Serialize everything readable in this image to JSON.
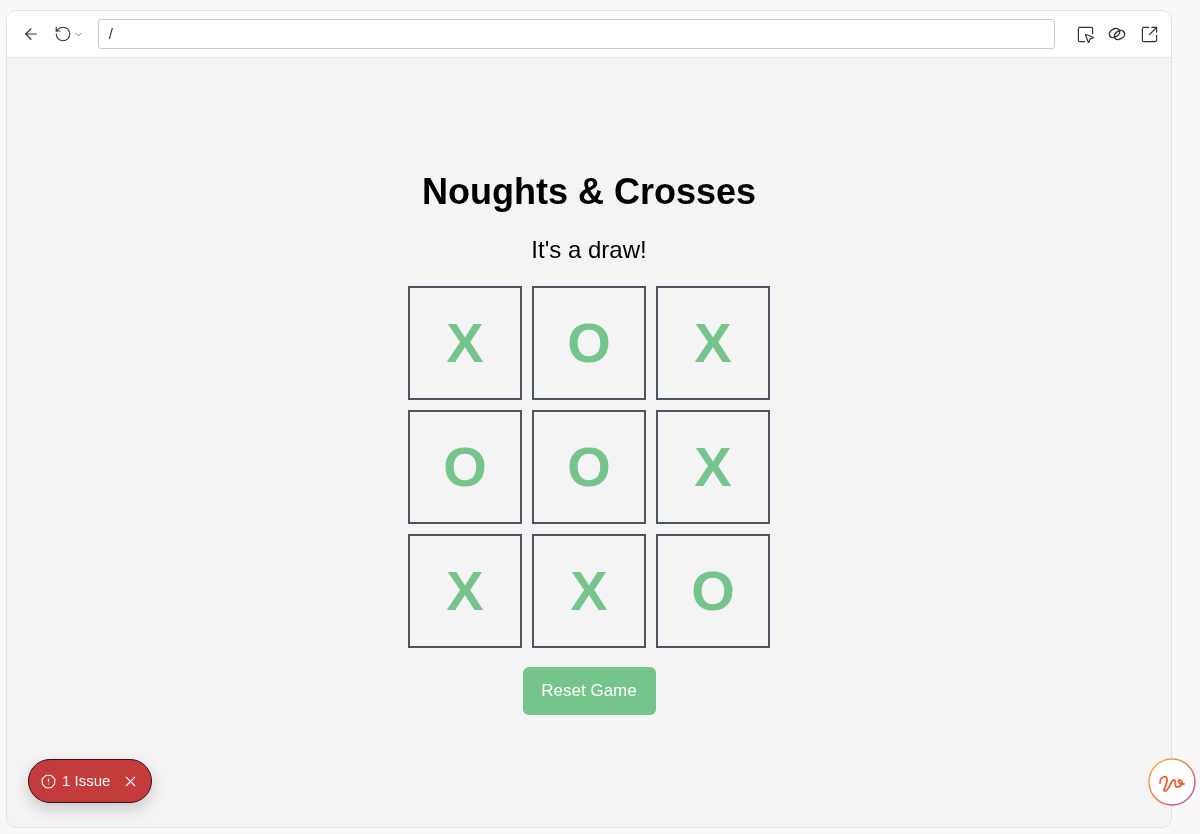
{
  "toolbar": {
    "address": "/"
  },
  "game": {
    "title": "Noughts & Crosses",
    "status": "It's a draw!",
    "board": [
      [
        "X",
        "O",
        "X"
      ],
      [
        "O",
        "O",
        "X"
      ],
      [
        "X",
        "X",
        "O"
      ]
    ],
    "reset_button": "Reset Game"
  },
  "issue_badge": {
    "label": "1 Issue"
  }
}
